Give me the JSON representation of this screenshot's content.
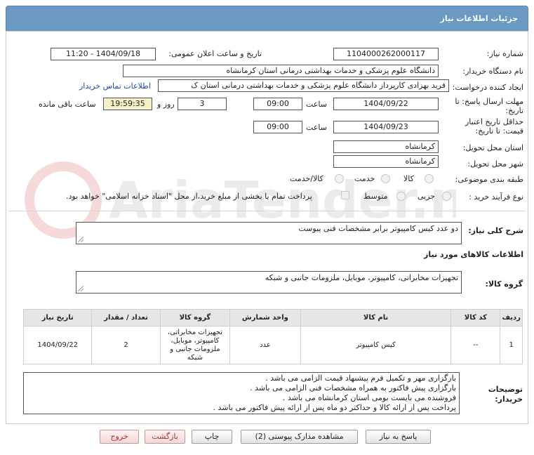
{
  "header": {
    "title": "جزئیات اطلاعات نیاز"
  },
  "fields": {
    "need_number": {
      "label": "شماره نیاز:",
      "value": "1104000262000117"
    },
    "announce_date": {
      "label": "تاریخ و ساعت اعلان عمومی:",
      "value": "1404/09/18 - 11:20"
    },
    "buyer_org": {
      "label": "نام دستگاه خریدار:",
      "value": "دانشگاه علوم پزشکی و خدمات بهداشتی  درمانی استان کرمانشاه"
    },
    "requester": {
      "label": "ایجاد کننده درخواست:",
      "value": "فرید  بهزادی کارپرداز دانشگاه علوم پزشکی و خدمات بهداشتی  درمانی استان ک",
      "link": "اطلاعات تماس خریدار"
    },
    "reply_deadline": {
      "label_line1": "مهلت ارسال پاسخ: تا",
      "label_line2": "تاریخ:",
      "date": "1404/09/22",
      "time_label": "ساعت",
      "time": "09:00",
      "days": "3",
      "days_label": "روز و",
      "remaining": "19:59:35",
      "remaining_label": "ساعت باقی مانده"
    },
    "price_validity": {
      "label_line1": "حداقل تاریخ اعتبار",
      "label_line2": "قیمت: تا تاریخ:",
      "date": "1404/09/23",
      "time_label": "ساعت",
      "time": "09:00"
    },
    "delivery_province": {
      "label": "استان محل تحویل:",
      "value": "کرمانشاه"
    },
    "delivery_city": {
      "label": "شهر محل تحویل:",
      "value": "کرمانشاه"
    },
    "category": {
      "label": "طبقه بندی موضوعی:",
      "options": [
        "کالا",
        "خدمت",
        "کالا/خدمت"
      ]
    },
    "purchase_type": {
      "label": "نوع فرآیند خرید :",
      "options": [
        "جزیی",
        "متوسط"
      ],
      "note": "پرداخت تمام یا بخشی از مبلغ خرید،از محل \"اسناد خزانه اسلامی\" خواهد بود."
    }
  },
  "description": {
    "label": "شرح کلی نیاز:",
    "value": "دو عدد کیس کامپیوتر برابر مشخصات فنی پیوست"
  },
  "goods_info": {
    "title": "اطلاعات کالاهای مورد نیاز",
    "group_label": "گروه کالا:",
    "group_value": "تجهیزات مخابراتی، کامپیوتر، موبایل، ملزومات جانبی و شبکه"
  },
  "table": {
    "headers": [
      "ردیف",
      "کد کالا",
      "نام کالا",
      "واحد شمارش",
      "گروه کالا",
      "تعداد / مقدار",
      "تاریخ نیاز"
    ],
    "rows": [
      {
        "row": "1",
        "code": "--",
        "name": "کیس کامپیوتر",
        "unit": "عدد",
        "group_lines": [
          "تجهیزات مخابراتی،",
          "کامپیوتر، موبایل،",
          "ملزومات جانبی و",
          "شبکه"
        ],
        "qty": "2",
        "date": "1404/09/22"
      }
    ]
  },
  "buyer_notes": {
    "label_line1": "توضیحات",
    "label_line2": "خریدار:",
    "lines": [
      "بارگزاری مهر و تکمیل فرم پیشنهاد قیمت الزامی می باشد .",
      "بارگزاری پیش فاکتور به همراه مشخصات فنی الزامی می باشد .",
      "فروشنده می بایست بومی استان کرمانشاه می باشد .",
      "پرداخت پس از ارائه کالا و حداکثر دو ماه پس از ارائه پیش فاکتور می باشد ."
    ]
  },
  "buttons": {
    "reply": "پاسخ به نیاز",
    "view_docs": "مشاهده مدارک پیوستی (2)",
    "print": "چاپ",
    "back": "بازگشت",
    "exit": "خروج"
  },
  "watermark": {
    "text": "AriaTender.net"
  },
  "colors": {
    "header_bg": "#6a9ac4",
    "link": "#1a49b8",
    "remaining_bg": "#f5f0c8"
  }
}
